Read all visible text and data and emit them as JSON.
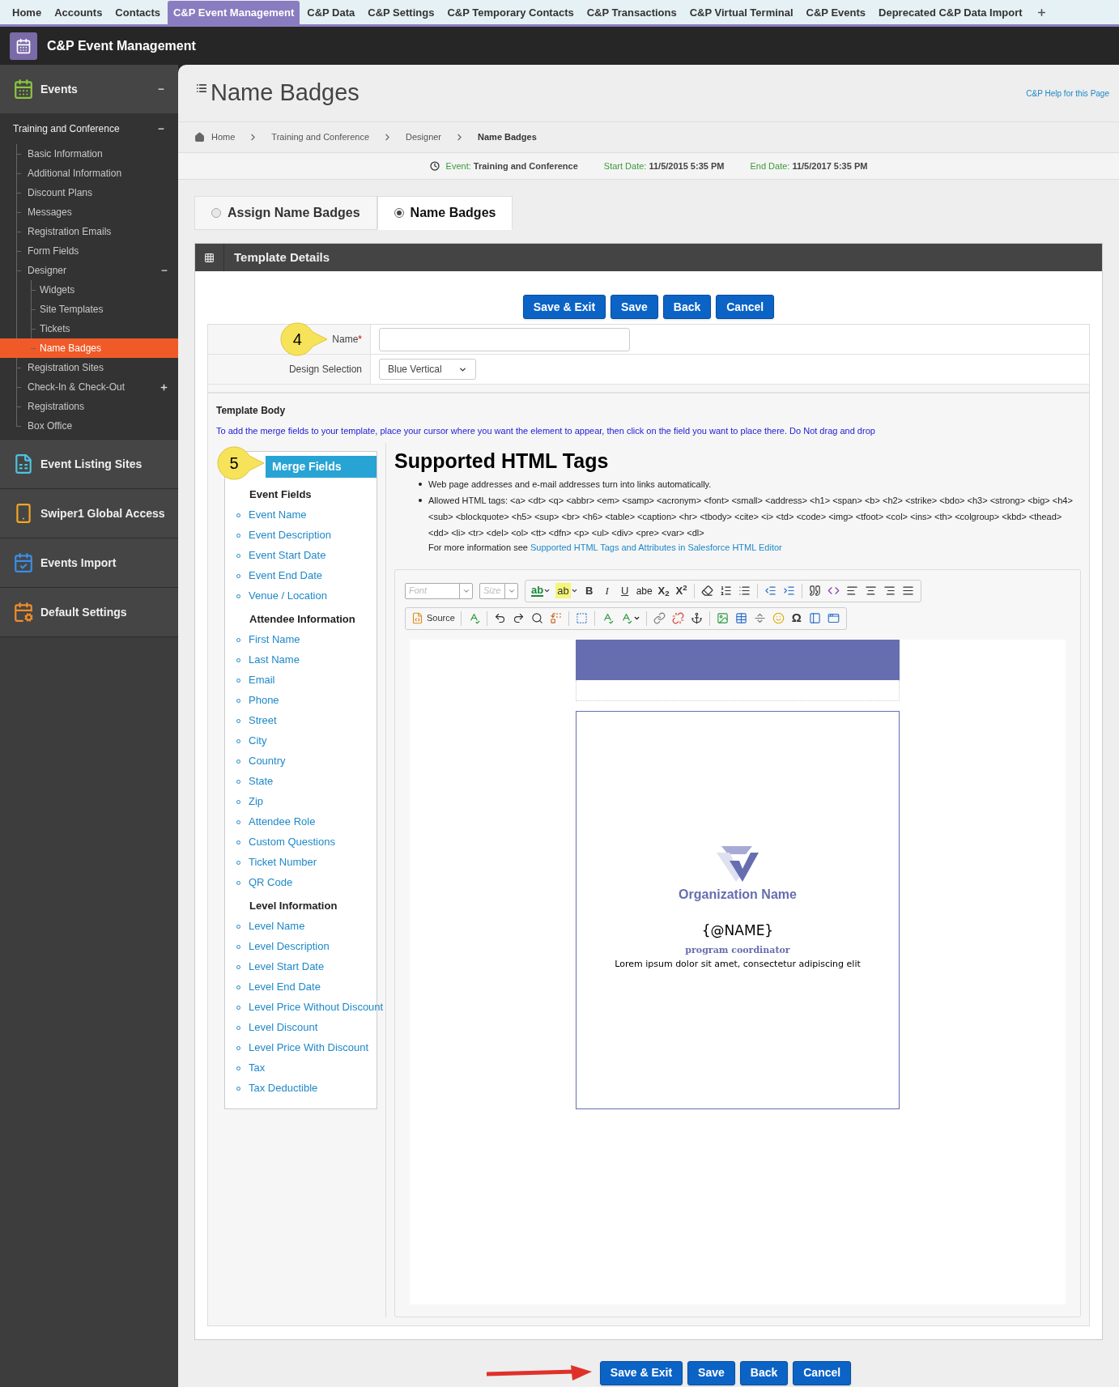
{
  "top_nav": {
    "tabs": [
      {
        "label": "Home",
        "selected": false
      },
      {
        "label": "Accounts",
        "selected": false
      },
      {
        "label": "Contacts",
        "selected": false
      },
      {
        "label": "C&P Event Management",
        "selected": true
      },
      {
        "label": "C&P Data",
        "selected": false
      },
      {
        "label": "C&P Settings",
        "selected": false
      },
      {
        "label": "C&P Temporary Contacts",
        "selected": false
      },
      {
        "label": "C&P Transactions",
        "selected": false
      },
      {
        "label": "C&P Virtual Terminal",
        "selected": false
      },
      {
        "label": "C&P Events",
        "selected": false
      },
      {
        "label": "Deprecated C&P Data Import",
        "selected": false
      }
    ]
  },
  "app_header": {
    "title": "C&P Event Management"
  },
  "sidebar": {
    "modules": [
      {
        "label": "Events",
        "expanded": true,
        "events": [
          {
            "label": "Training and Conference",
            "expanded": true,
            "items": [
              {
                "label": "Basic Information",
                "selected": false
              },
              {
                "label": "Additional Information",
                "selected": false
              },
              {
                "label": "Discount Plans",
                "selected": false
              },
              {
                "label": "Messages",
                "selected": false
              },
              {
                "label": "Registration Emails",
                "selected": false
              },
              {
                "label": "Form Fields",
                "selected": false
              },
              {
                "label": "Designer",
                "selected": false,
                "expanded": true,
                "children": [
                  {
                    "label": "Widgets",
                    "selected": false
                  },
                  {
                    "label": "Site Templates",
                    "selected": false
                  },
                  {
                    "label": "Tickets",
                    "selected": false
                  },
                  {
                    "label": "Name Badges",
                    "selected": true
                  }
                ]
              },
              {
                "label": "Registration Sites",
                "selected": false
              },
              {
                "label": "Check-In & Check-Out",
                "selected": false,
                "expanded": false
              },
              {
                "label": "Registrations",
                "selected": false
              },
              {
                "label": "Box Office",
                "selected": false
              }
            ]
          }
        ]
      },
      {
        "label": "Event Listing Sites"
      },
      {
        "label": "Swiper1 Global Access"
      },
      {
        "label": "Events Import"
      },
      {
        "label": "Default Settings"
      }
    ]
  },
  "page": {
    "title": "Name Badges",
    "help_link": "C&P Help for this Page",
    "breadcrumb": [
      {
        "label": "Home",
        "current": false
      },
      {
        "label": "Training and Conference",
        "current": false
      },
      {
        "label": "Designer",
        "current": false
      },
      {
        "label": "Name Badges",
        "current": true
      }
    ]
  },
  "event_bar": [
    {
      "label": "Event:",
      "value": "Training and Conference"
    },
    {
      "label": "Start Date:",
      "value": "11/5/2015 5:35 PM"
    },
    {
      "label": "End Date:",
      "value": "11/5/2017 5:35 PM"
    }
  ],
  "mode_tabs": [
    {
      "label": "Assign Name Badges",
      "selected": false
    },
    {
      "label": "Name Badges",
      "selected": true
    }
  ],
  "template_details": {
    "title": "Template Details",
    "buttons": [
      "Save & Exit",
      "Save",
      "Back",
      "Cancel"
    ],
    "fields": [
      {
        "kind": "text",
        "label": "Name",
        "required_mark": "*",
        "callout": "4"
      },
      {
        "kind": "select",
        "label": "Design Selection",
        "value": "Blue Vertical"
      }
    ]
  },
  "template_body": {
    "title": "Template Body",
    "instructions": "To add the merge fields to your template, place your cursor where you want the element to appear, then click on the field you want to place there. Do Not drag and drop"
  },
  "merge_fields": {
    "title": "Merge Fields",
    "callout": "5",
    "groups": [
      {
        "heading": "Event Fields",
        "items": [
          "Event Name",
          "Event Description",
          "Event Start Date",
          "Event End Date",
          "Venue / Location"
        ]
      },
      {
        "heading": "Attendee Information",
        "items": [
          "First Name",
          "Last Name",
          "Email",
          "Phone",
          "Street",
          "City",
          "Country",
          "State",
          "Zip",
          "Attendee Role",
          "Custom Questions",
          "Ticket Number",
          "QR Code"
        ]
      },
      {
        "heading": "Level Information",
        "items": [
          "Level Name",
          "Level Description",
          "Level Start Date",
          "Level End Date",
          "Level Price Without Discount",
          "Level Discount",
          "Level Price With Discount",
          "Tax",
          "Tax Deductible"
        ]
      }
    ]
  },
  "html_tags": {
    "title": "Supported HTML Tags",
    "bullets": [
      "Web page addresses and e-mail addresses turn into links automatically.",
      "Allowed HTML tags: <a> <dt> <q> <abbr> <em> <samp> <acronym> <font> <small> <address> <h1> <span> <b> <h2> <strike> <bdo> <h3> <strong> <big> <h4> <sub> <blockquote> <h5> <sup> <br> <h6> <table> <caption> <hr> <tbody> <cite> <i> <td> <code> <img> <tfoot> <col> <ins> <th> <colgroup> <kbd> <thead> <dd> <li> <tr> <del> <ol> <tt> <dfn> <p> <ul> <div> <pre> <var> <dl>"
    ],
    "more_info": "For more information see",
    "link": "Supported HTML Tags and Attributes in Salesforce HTML Editor"
  },
  "editor": {
    "font_placeholder": "Font",
    "size_placeholder": "Size",
    "format_buttons": [
      "ab",
      "ab",
      "B",
      "I",
      "U",
      "abe",
      "X$_{2}$",
      "X$^{2}$"
    ],
    "source_label": "Source",
    "special_char": "Ω"
  },
  "badge": {
    "organization": "Organization Name",
    "name_token": "{@NAME}",
    "role": "program coordinator",
    "tagline": "Lorem ipsum dolor sit amet, consectetur adipiscing elit"
  },
  "bottom_buttons": [
    "Save & Exit",
    "Save",
    "Back",
    "Cancel"
  ]
}
